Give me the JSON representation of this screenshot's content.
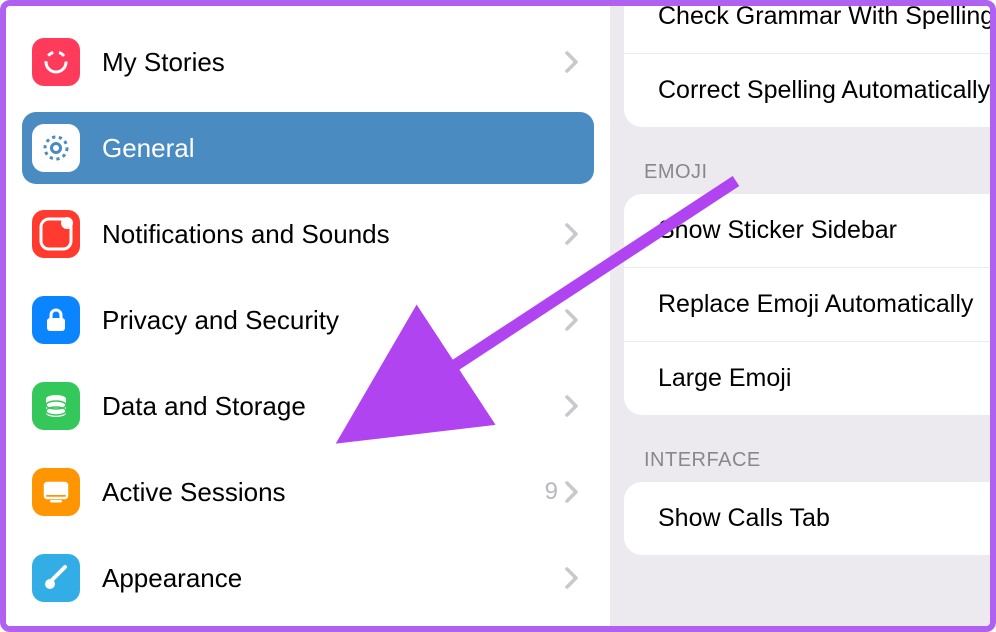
{
  "sidebar": {
    "items": [
      {
        "id": "my-stories",
        "label": "My Stories",
        "icon": "stories-icon",
        "color": "#ff3b5c",
        "badge": ""
      },
      {
        "id": "general",
        "label": "General",
        "icon": "gear-icon",
        "color": "#4a8bc2",
        "selected": true
      },
      {
        "id": "notifications",
        "label": "Notifications and Sounds",
        "icon": "bell-icon",
        "color": "#ff3b30",
        "badge": ""
      },
      {
        "id": "privacy",
        "label": "Privacy and Security",
        "icon": "lock-icon",
        "color": "#0a84ff",
        "badge": ""
      },
      {
        "id": "data-storage",
        "label": "Data and Storage",
        "icon": "database-icon",
        "color": "#34c759",
        "badge": ""
      },
      {
        "id": "active-sessions",
        "label": "Active Sessions",
        "icon": "monitor-icon",
        "color": "#ff9500",
        "badge": "9"
      },
      {
        "id": "appearance",
        "label": "Appearance",
        "icon": "brush-icon",
        "color": "#32ade6",
        "badge": ""
      }
    ]
  },
  "right": {
    "grammar_group": [
      "Check Grammar With Spelling",
      "Correct Spelling Automatically"
    ],
    "emoji_header": "EMOJI",
    "emoji_group": [
      "Show Sticker Sidebar",
      "Replace Emoji Automatically",
      "Large Emoji"
    ],
    "interface_header": "INTERFACE",
    "interface_group": [
      "Show Calls Tab"
    ]
  }
}
